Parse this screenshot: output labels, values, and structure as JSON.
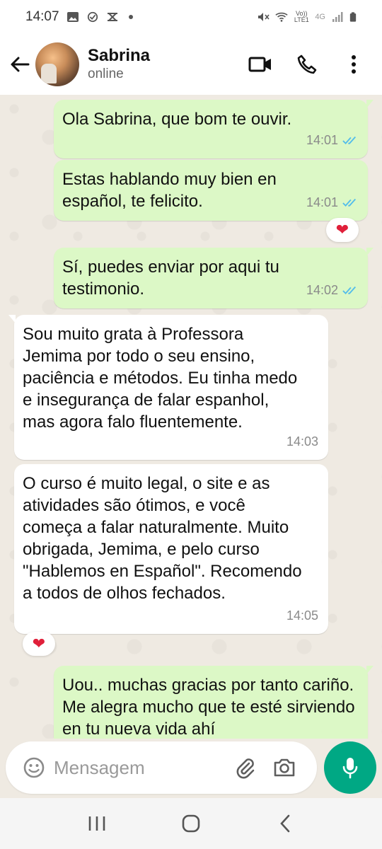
{
  "status_bar": {
    "time": "14:07",
    "network_label": "4G",
    "volte_label": "Vo)) LTE1"
  },
  "header": {
    "contact_name": "Sabrina",
    "contact_status": "online"
  },
  "messages": [
    {
      "direction": "out",
      "text": "Ola Sabrina, que bom te ouvir.",
      "time": "14:01",
      "status": "read"
    },
    {
      "direction": "out",
      "text": "Estas hablando muy bien en español, te felicito.",
      "time": "14:01",
      "status": "read",
      "reaction": "heart"
    },
    {
      "direction": "out",
      "text": "Sí, puedes enviar por aqui tu testimonio.",
      "time": "14:02",
      "status": "read"
    },
    {
      "direction": "in",
      "text": "Sou muito grata à Professora Jemima por todo o seu ensino, paciência e métodos. Eu tinha medo e insegurança de falar espanhol, mas agora falo fluentemente.",
      "time": "14:03"
    },
    {
      "direction": "in",
      "text": "O curso é muito legal, o site e as atividades são ótimos, e você começa a falar naturalmente. Muito obrigada, Jemima, e pelo curso \"Hablemos en Español\". Recomendo a todos de olhos fechados.",
      "time": "14:05",
      "reaction": "heart"
    },
    {
      "direction": "out",
      "text": "Uou.. muchas gracias por tanto cariño. Me alegra mucho que te esté sirviendo en tu nueva vida ahí"
    }
  ],
  "input": {
    "placeholder": "Mensagem"
  },
  "colors": {
    "outgoing_bubble": "#dcf8c6",
    "incoming_bubble": "#ffffff",
    "accent": "#00a884",
    "read_tick": "#53bdeb",
    "chat_background": "#efeae2"
  },
  "icons": {
    "header": [
      "back-arrow-icon",
      "video-call-icon",
      "phone-icon",
      "more-options-icon"
    ],
    "input": [
      "emoji-icon",
      "attach-icon",
      "camera-icon",
      "microphone-icon"
    ],
    "nav": [
      "recent-apps-icon",
      "home-icon",
      "back-icon"
    ]
  }
}
